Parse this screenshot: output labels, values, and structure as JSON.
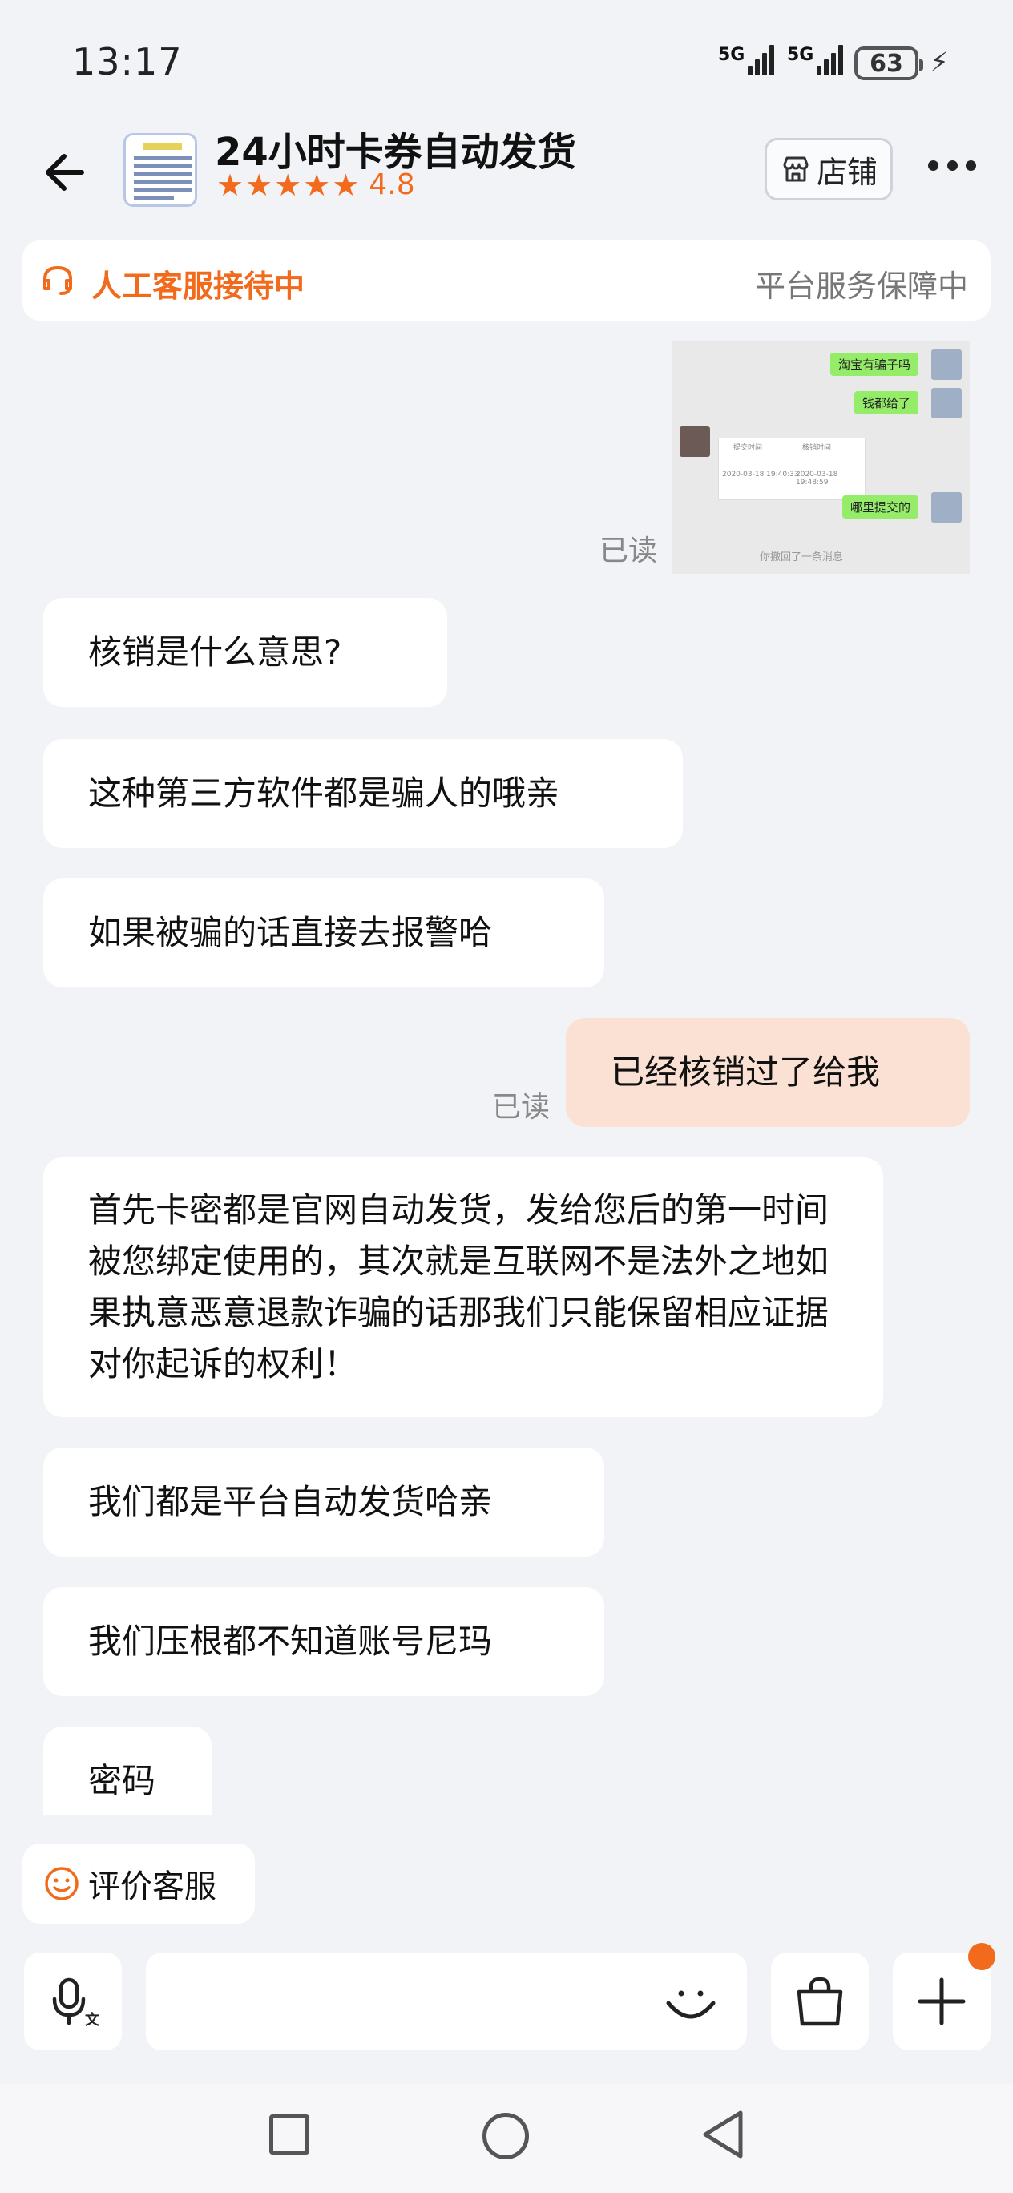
{
  "status": {
    "time": "13:17",
    "signal1": "5G",
    "signal2": "5G",
    "battery": "63"
  },
  "header": {
    "title": "24小时卡券自动发货",
    "rating": "4.8",
    "stars": 5,
    "store_label": "店铺"
  },
  "banner": {
    "left": "人工客服接待中",
    "right": "平台服务保障中"
  },
  "screenshot_msg": {
    "bubble1": "淘宝有骗子吗",
    "bubble2": "钱都给了",
    "bubble3": "哪里提交的",
    "card_col1": "提交时间",
    "card_col2": "核销时间",
    "card_val1": "2020-03-18 19:40:33",
    "card_val2": "2020-03-18 19:48:59",
    "recall_note": "你撤回了一条消息"
  },
  "messages": {
    "read_label": "已读",
    "m1": "核销是什么意思?",
    "m2": "这种第三方软件都是骗人的哦亲",
    "m3": "如果被骗的话直接去报警哈",
    "m4": "已经核销过了给我",
    "m5": "首先卡密都是官网自动发货，发给您后的第一时间被您绑定使用的，其次就是互联网不是法外之地如果执意恶意退款诈骗的话那我们只能保留相应证据对你起诉的权利！",
    "m6": "我们都是平台自动发货哈亲",
    "m7": "我们压根都不知道账号尼玛",
    "m8": "密码"
  },
  "rate_agent": {
    "label": "评价客服"
  },
  "colors": {
    "accent": "#f26a1b",
    "mine_bubble": "#fbe1d3",
    "background": "#f2f3f7"
  }
}
